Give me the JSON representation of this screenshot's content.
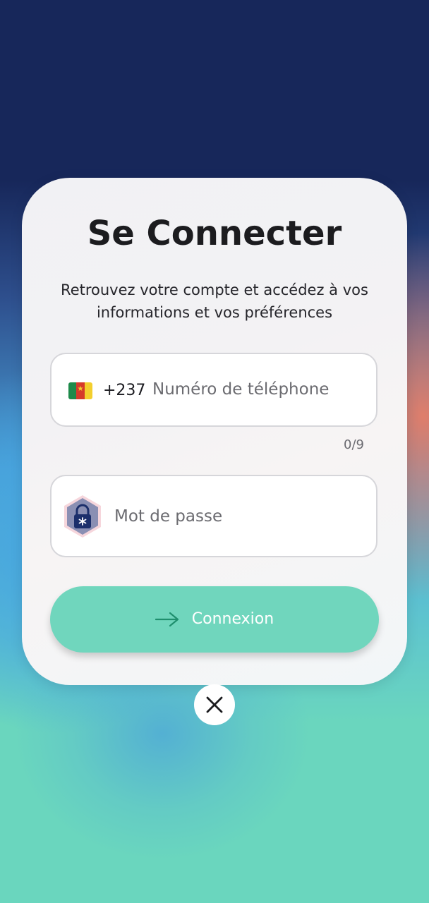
{
  "login": {
    "title": "Se Connecter",
    "subtitle": "Retrouvez votre compte et accédez à vos informations et vos préférences",
    "phone": {
      "flag_icon": "cameroon-flag-icon",
      "dial_code": "+237",
      "value": "",
      "placeholder": "Numéro de téléphone",
      "counter": "0/9"
    },
    "password": {
      "icon": "lock-icon",
      "value": "",
      "placeholder": "Mot de passe"
    },
    "submit": {
      "icon": "arrow-right-icon",
      "label": "Connexion"
    },
    "close": {
      "icon": "close-icon"
    }
  },
  "colors": {
    "background_top": "#17275a",
    "background_bottom": "#6ad6be",
    "accent": "#70d6bd",
    "card": "#f2f2f5",
    "text": "#1c1c1f",
    "lock_badge": "#8a8fb3",
    "lock_body": "#1c2f6b"
  }
}
